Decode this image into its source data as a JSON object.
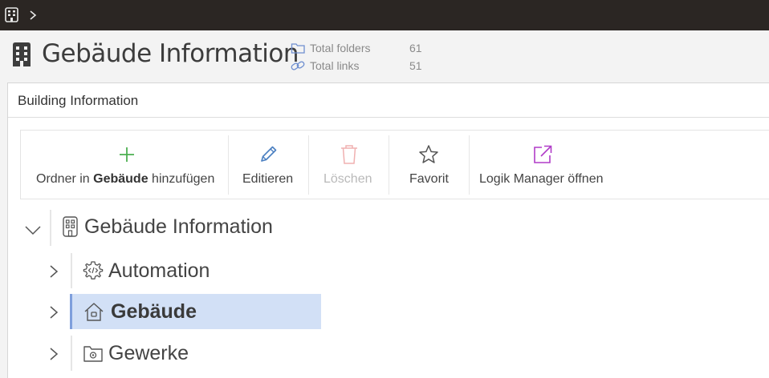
{
  "topbar": {
    "icons": [
      "building-icon",
      "chevron-right-icon"
    ]
  },
  "header": {
    "title": "Gebäude Information",
    "stats": [
      {
        "icon": "folder-icon",
        "label": "Total folders",
        "value": "61"
      },
      {
        "icon": "link-icon",
        "label": "Total links",
        "value": "51"
      }
    ]
  },
  "panel": {
    "title": "Building Information"
  },
  "toolbar": {
    "add": {
      "pre": "Ordner in ",
      "bold": "Gebäude",
      "post": " hinzufügen",
      "icon": "plus-icon",
      "color": "#4caf50"
    },
    "edit": {
      "label": "Editieren",
      "icon": "pencil-icon",
      "color": "#4a7fc1"
    },
    "delete": {
      "label": "Löschen",
      "icon": "trash-icon",
      "color": "#f0b0b0",
      "disabled": true
    },
    "favorite": {
      "label": "Favorit",
      "icon": "star-icon",
      "color": "#555555"
    },
    "logic": {
      "label": "Logik Manager öffnen",
      "icon": "external-link-icon",
      "color": "#b03cc8"
    }
  },
  "tree": {
    "root": {
      "label": "Gebäude Information",
      "icon": "building-icon",
      "expanded": true
    },
    "children": [
      {
        "label": "Automation",
        "icon": "gear-code-icon",
        "selected": false
      },
      {
        "label": "Gebäude",
        "icon": "house-icon",
        "selected": true
      },
      {
        "label": "Gewerke",
        "icon": "folder-gear-icon",
        "selected": false
      }
    ]
  },
  "colors": {
    "topbar": "#2b2623",
    "selection": "#d2e0f6",
    "selection_bar": "#7f9fdc"
  }
}
